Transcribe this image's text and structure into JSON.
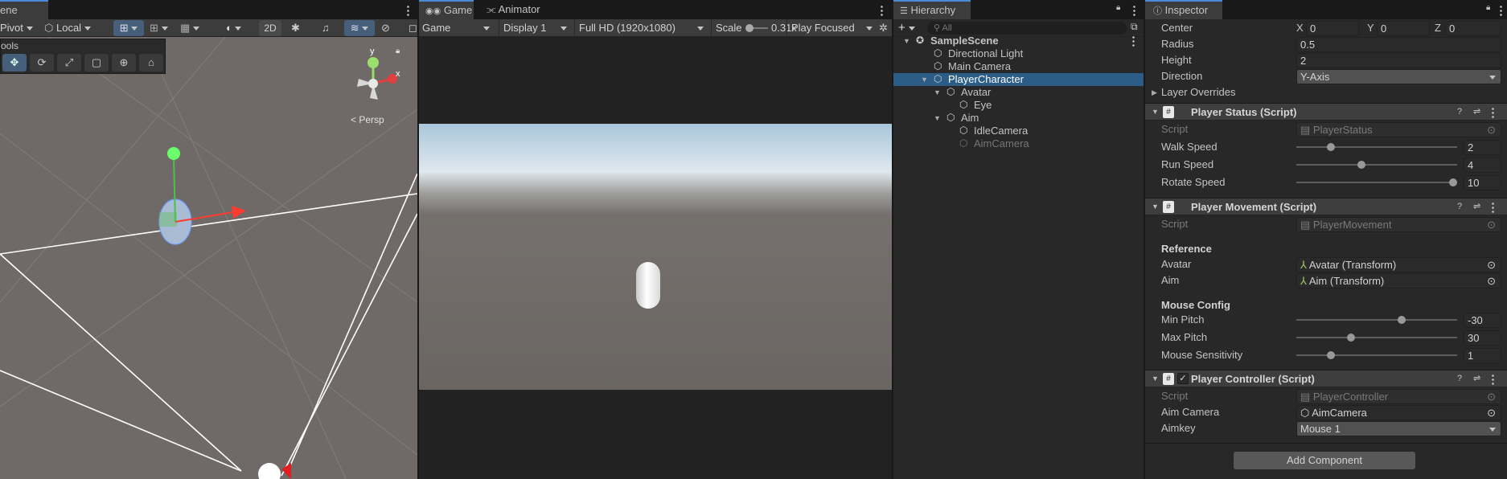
{
  "scene": {
    "tab_label": "ene",
    "pivot_label": "Pivot",
    "local_label": "Local",
    "mode_2d": "2D",
    "tools_label": "ools",
    "persp_label": "Persp",
    "gizmo_y": "y",
    "gizmo_x": "x"
  },
  "game": {
    "tab_game": "Game",
    "tab_animator": "Animator",
    "view_mode": "Game",
    "display": "Display 1",
    "resolution": "Full HD (1920x1080)",
    "scale_label": "Scale",
    "scale_value": "0.31x",
    "play_mode": "Play Focused"
  },
  "hierarchy": {
    "tab_label": "Hierarchy",
    "search_placeholder": "All",
    "items": [
      {
        "label": "SampleScene",
        "kind": "scene"
      },
      {
        "label": "Directional Light",
        "kind": "object"
      },
      {
        "label": "Main Camera",
        "kind": "object"
      },
      {
        "label": "PlayerCharacter",
        "kind": "object",
        "selected": true
      },
      {
        "label": "Avatar",
        "kind": "object"
      },
      {
        "label": "Eye",
        "kind": "object"
      },
      {
        "label": "Aim",
        "kind": "object"
      },
      {
        "label": "IdleCamera",
        "kind": "object"
      },
      {
        "label": "AimCamera",
        "kind": "object",
        "inactive": true
      }
    ]
  },
  "inspector": {
    "tab_label": "Inspector",
    "collider": {
      "center_label": "Center",
      "center_x_label": "X",
      "center_x": "0",
      "center_y_label": "Y",
      "center_y": "0",
      "center_z_label": "Z",
      "center_z": "0",
      "radius_label": "Radius",
      "radius": "0.5",
      "height_label": "Height",
      "height": "2",
      "direction_label": "Direction",
      "direction": "Y-Axis",
      "layer_overrides": "Layer Overrides"
    },
    "player_status": {
      "title": "Player Status (Script)",
      "script_label": "Script",
      "script": "PlayerStatus",
      "walk_label": "Walk Speed",
      "walk": "2",
      "run_label": "Run Speed",
      "run": "4",
      "rotate_label": "Rotate Speed",
      "rotate": "10"
    },
    "player_movement": {
      "title": "Player Movement (Script)",
      "script_label": "Script",
      "script": "PlayerMovement",
      "reference_header": "Reference",
      "avatar_label": "Avatar",
      "avatar": "Avatar (Transform)",
      "aim_label": "Aim",
      "aim": "Aim (Transform)",
      "mouse_header": "Mouse Config",
      "min_pitch_label": "Min Pitch",
      "min_pitch": "-30",
      "max_pitch_label": "Max Pitch",
      "max_pitch": "30",
      "sens_label": "Mouse Sensitivity",
      "sens": "1"
    },
    "player_controller": {
      "title": "Player Controller (Script)",
      "script_label": "Script",
      "script": "PlayerController",
      "aim_camera_label": "Aim Camera",
      "aim_camera": "AimCamera",
      "aimkey_label": "Aimkey",
      "aimkey": "Mouse 1"
    },
    "add_component": "Add Component"
  }
}
